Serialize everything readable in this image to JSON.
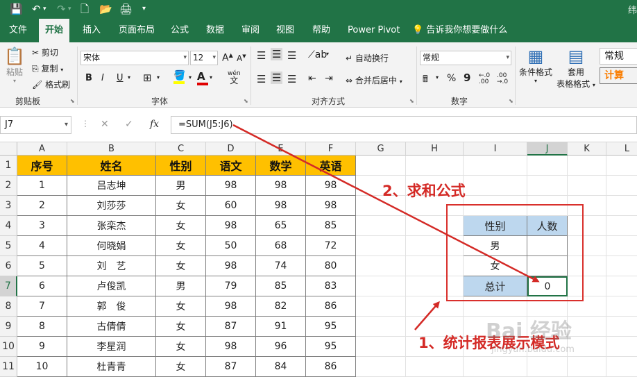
{
  "window": {
    "title_fragment": "纬"
  },
  "tabs": [
    "文件",
    "开始",
    "插入",
    "页面布局",
    "公式",
    "数据",
    "审阅",
    "视图",
    "帮助",
    "Power Pivot",
    "告诉我你想要做什么"
  ],
  "ribbon": {
    "clipboard": {
      "paste": "粘贴",
      "cut": "剪切",
      "copy": "复制",
      "format_painter": "格式刷",
      "label": "剪贴板"
    },
    "font": {
      "name": "宋体",
      "size": "12",
      "grow": "A",
      "shrink": "A",
      "bold": "B",
      "italic": "I",
      "underline": "U",
      "label": "字体",
      "wen": "wén"
    },
    "alignment": {
      "wrap": "自动换行",
      "merge": "合并后居中",
      "label": "对齐方式"
    },
    "number": {
      "format": "常规",
      "label": "数字",
      "percent": "%",
      "comma": "9"
    },
    "styles": {
      "conditional": "条件格式",
      "table": "套用",
      "table2": "表格格式",
      "normal": "常规",
      "calc": "计算"
    }
  },
  "formula_bar": {
    "name_box": "J7",
    "fx": "fx",
    "formula": "=SUM(J5:J6)"
  },
  "columns": [
    "A",
    "B",
    "C",
    "D",
    "E",
    "F",
    "G",
    "H",
    "I",
    "J",
    "K",
    "L"
  ],
  "rows": [
    "1",
    "2",
    "3",
    "4",
    "5",
    "6",
    "7",
    "8",
    "9",
    "10",
    "11"
  ],
  "table1": {
    "header": [
      "序号",
      "姓名",
      "性别",
      "语文",
      "数学",
      "英语"
    ],
    "rows": [
      [
        "1",
        "吕志坤",
        "男",
        "98",
        "98",
        "98"
      ],
      [
        "2",
        "刘莎莎",
        "女",
        "60",
        "98",
        "98"
      ],
      [
        "3",
        "张栾杰",
        "女",
        "98",
        "65",
        "85"
      ],
      [
        "4",
        "何晓娟",
        "女",
        "50",
        "68",
        "72"
      ],
      [
        "5",
        "刘　艺",
        "女",
        "98",
        "74",
        "80"
      ],
      [
        "6",
        "卢俊凯",
        "男",
        "79",
        "85",
        "83"
      ],
      [
        "7",
        "郭　俊",
        "女",
        "98",
        "82",
        "86"
      ],
      [
        "8",
        "古倩倩",
        "女",
        "87",
        "91",
        "95"
      ],
      [
        "9",
        "李星润",
        "女",
        "98",
        "96",
        "95"
      ],
      [
        "10",
        "杜青青",
        "女",
        "87",
        "84",
        "86"
      ]
    ]
  },
  "table2": {
    "header": [
      "性别",
      "人数"
    ],
    "rows": [
      [
        "男",
        ""
      ],
      [
        "女",
        ""
      ]
    ],
    "total": [
      "总计",
      "0"
    ]
  },
  "annotations": {
    "formula_note": "2、求和公式",
    "table_note": "1、统计报表展示模式"
  },
  "watermark": {
    "brand": "Bai 经验",
    "url": "jingyan.baidu.com"
  },
  "colors": {
    "excel_green": "#217346",
    "header_fill": "#ffc000",
    "table2_fill": "#bdd7ee",
    "annotation_red": "#d42a26"
  }
}
